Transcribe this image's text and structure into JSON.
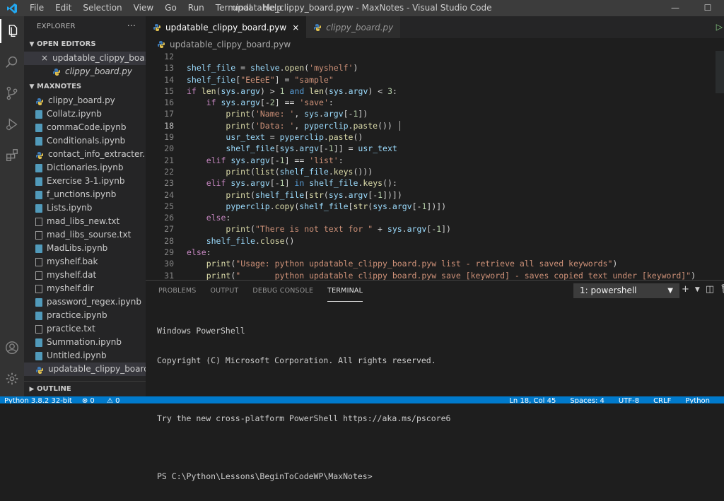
{
  "menu": [
    "File",
    "Edit",
    "Selection",
    "View",
    "Go",
    "Run",
    "Terminal",
    "Help"
  ],
  "window_title": "updatable_clippy_board.pyw - MaxNotes - Visual Studio Code",
  "sidebar": {
    "title": "EXPLORER",
    "more": "···",
    "open_editors_label": "OPEN EDITORS",
    "open_editors": [
      {
        "close": "×",
        "name": "updatable_clippy_boa..."
      },
      {
        "name": "clippy_board.py"
      }
    ],
    "folder_label": "MAXNOTES",
    "files": [
      "clippy_board.py",
      "Collatz.ipynb",
      "commaCode.ipynb",
      "Conditionals.ipynb",
      "contact_info_extracter.py",
      "Dictionaries.ipynb",
      "Exercise 3-1.ipynb",
      "f_unctions.ipynb",
      "Lists.ipynb",
      "mad_libs_new.txt",
      "mad_libs_sourse.txt",
      "MadLibs.ipynb",
      "myshelf.bak",
      "myshelf.dat",
      "myshelf.dir",
      "password_regex.ipynb",
      "practice.ipynb",
      "practice.txt",
      "Summation.ipynb",
      "Untitled.ipynb",
      "updatable_clippy_board.pyw"
    ],
    "outline_label": "OUTLINE"
  },
  "tabs": {
    "active": {
      "label": "updatable_clippy_board.pyw",
      "close": "×"
    },
    "inactive": {
      "label": "clippy_board.py"
    }
  },
  "breadcrumb": "updatable_clippy_board.pyw",
  "code": {
    "line_numbers": [
      "12",
      "13",
      "14",
      "15",
      "16",
      "17",
      "18",
      "19",
      "20",
      "21",
      "22",
      "23",
      "24",
      "25",
      "26",
      "27",
      "28",
      "29",
      "30",
      "31"
    ]
  },
  "panel": {
    "tabs": [
      "PROBLEMS",
      "OUTPUT",
      "DEBUG CONSOLE",
      "TERMINAL"
    ],
    "terminal_select": "1: powershell",
    "terminal_lines": [
      "Windows PowerShell",
      "Copyright (C) Microsoft Corporation. All rights reserved.",
      "",
      "Try the new cross-platform PowerShell https://aka.ms/pscore6",
      "",
      "PS C:\\Python\\Lessons\\BeginToCodeWP\\MaxNotes>"
    ]
  },
  "statusbar": {
    "python": "Python 3.8.2 32-bit",
    "errors": "⊗ 0",
    "warnings": "⚠ 0",
    "position": "Ln 18, Col 45",
    "spaces": "Spaces: 4",
    "encoding": "UTF-8",
    "eol": "CRLF",
    "language": "Python"
  },
  "colors": {
    "accent": "#007acc",
    "keyword": "#c586c0",
    "string": "#ce9178",
    "function": "#dcdcaa"
  }
}
